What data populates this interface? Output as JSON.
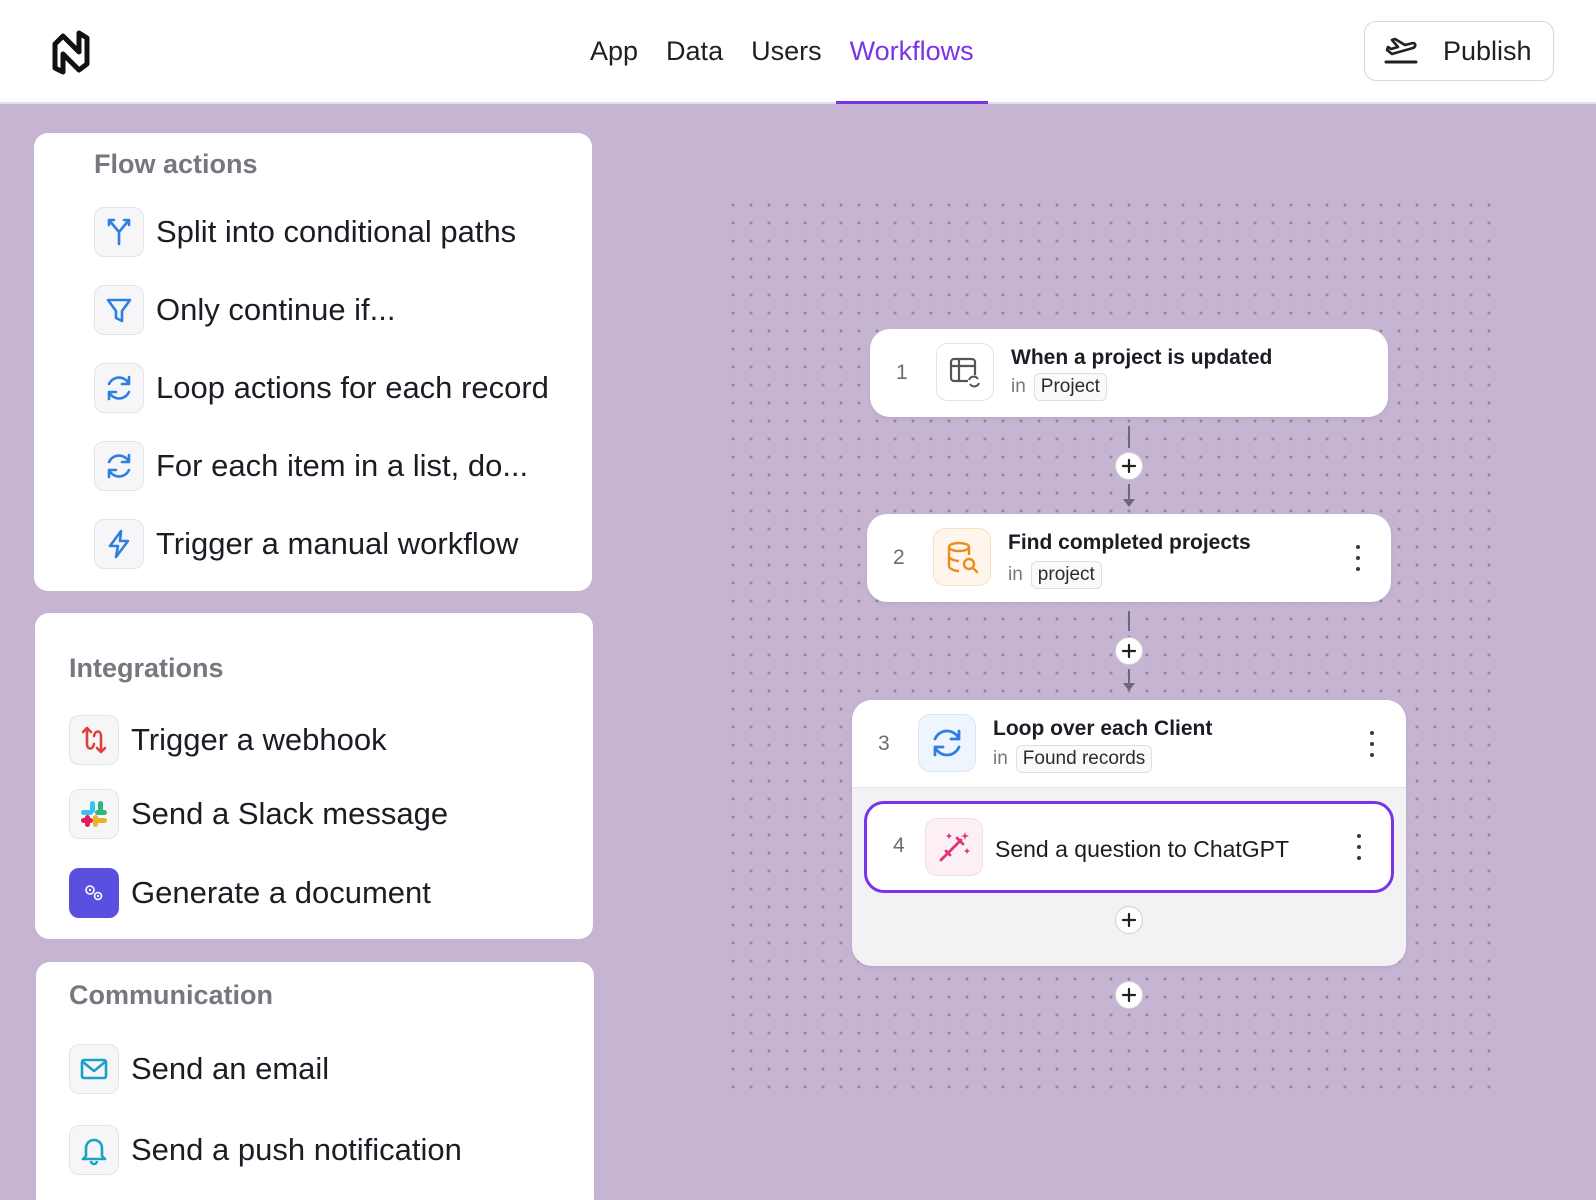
{
  "nav": {
    "items": [
      {
        "label": "App",
        "active": false
      },
      {
        "label": "Data",
        "active": false
      },
      {
        "label": "Users",
        "active": false
      },
      {
        "label": "Workflows",
        "active": true
      }
    ],
    "publish_label": "Publish"
  },
  "colors": {
    "accent": "#7a33e6",
    "background": "#c5b5d2",
    "loop_blue": "#2f7fe0",
    "database_orange": "#f08a1c",
    "magic_pink": "#e0337a",
    "webhook_red": "#e0413a",
    "doc_purple": "#5b4fe0",
    "comm_teal": "#1aa1c4"
  },
  "flow_actions": {
    "title": "Flow actions",
    "items": [
      {
        "label": "Split into conditional paths",
        "icon": "split-icon"
      },
      {
        "label": "Only continue if...",
        "icon": "filter-icon"
      },
      {
        "label": "Loop actions for each record",
        "icon": "loop-icon"
      },
      {
        "label": "For each item in a list, do...",
        "icon": "loop-icon"
      },
      {
        "label": "Trigger a manual workflow",
        "icon": "lightning-icon"
      }
    ]
  },
  "integrations": {
    "title": "Integrations",
    "items": [
      {
        "label": "Trigger a webhook",
        "icon": "webhook-icon"
      },
      {
        "label": "Send a Slack message",
        "icon": "slack-icon"
      },
      {
        "label": "Generate a document",
        "icon": "document-icon"
      }
    ]
  },
  "communication": {
    "title": "Communication",
    "items": [
      {
        "label": "Send an email",
        "icon": "mail-icon"
      },
      {
        "label": "Send a push notification",
        "icon": "bell-icon"
      }
    ]
  },
  "workflow": {
    "steps": [
      {
        "number": "1",
        "title": "When a project is updated",
        "in_label": "in",
        "source": "Project",
        "icon": "table-refresh-icon"
      },
      {
        "number": "2",
        "title": "Find completed projects",
        "in_label": "in",
        "source": "project",
        "icon": "database-search-icon"
      },
      {
        "number": "3",
        "title": "Loop over each Client",
        "in_label": "in",
        "source": "Found records",
        "icon": "loop-icon"
      },
      {
        "number": "4",
        "title": "Send a question to ChatGPT",
        "icon": "magic-wand-icon"
      }
    ]
  }
}
